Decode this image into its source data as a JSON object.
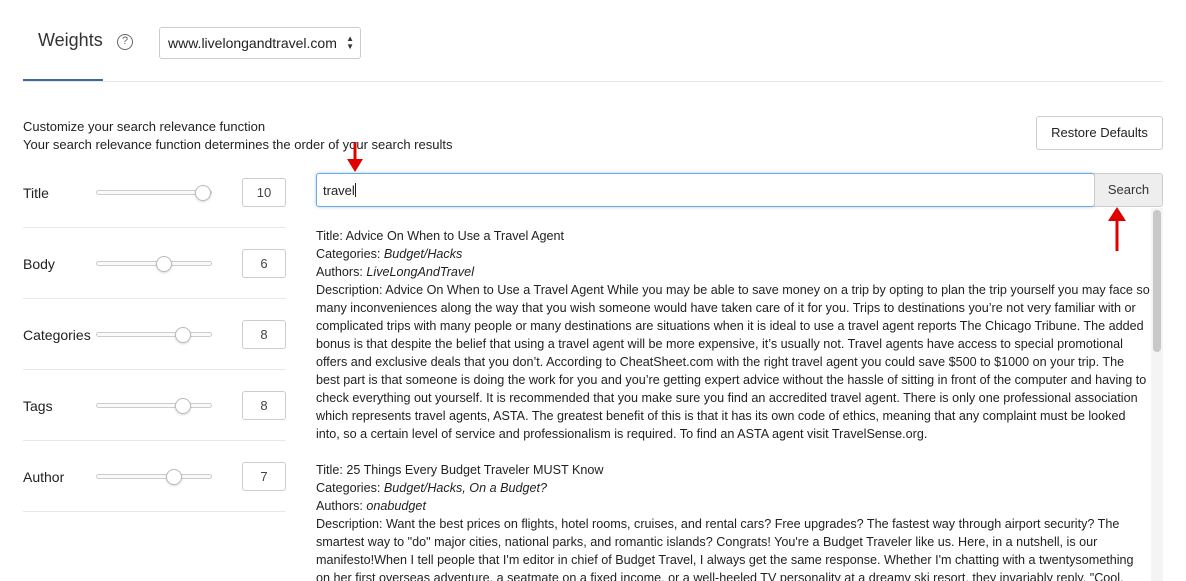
{
  "header": {
    "title": "Weights",
    "help_icon": "question-circle-icon",
    "site_select": "www.livelongandtravel.com"
  },
  "description": {
    "line1": "Customize your search relevance function",
    "line2": "Your search relevance function determines the order of your search results"
  },
  "restore_label": "Restore Defaults",
  "weights": [
    {
      "label": "Title",
      "value": "10",
      "level": 1.0
    },
    {
      "label": "Body",
      "value": "6",
      "level": 0.6
    },
    {
      "label": "Categories",
      "value": "8",
      "level": 0.8
    },
    {
      "label": "Tags",
      "value": "8",
      "level": 0.8
    },
    {
      "label": "Author",
      "value": "7",
      "level": 0.7
    }
  ],
  "search": {
    "value": "travel",
    "button_label": "Search"
  },
  "results": [
    {
      "title_label": "Title: ",
      "title": "Advice On When to Use a Travel Agent",
      "categories_label": "Categories: ",
      "categories": "Budget/Hacks",
      "authors_label": "Authors: ",
      "authors": "LiveLongAndTravel",
      "description_label": "Description: ",
      "description": "Advice On When to Use a Travel Agent While you may be able to save money on a trip by opting to plan the trip yourself you may face so many inconveniences along the way that you wish someone would have taken care of it for you. Trips to destinations you’re not very familiar with or complicated trips with many people or many destinations are situations when it is ideal to use a travel agent reports The Chicago Tribune. The added bonus is that despite the belief that using a travel agent will be more expensive, it’s usually not. Travel agents have access to special promotional offers and exclusive deals that you don’t. According to CheatSheet.com with the right travel agent you could save $500 to $1000 on your trip.  The best part is that someone is doing the work for you and you’re getting expert advice without the hassle of sitting in front of the computer and having to check everything out yourself. It is recommended that you make sure you find an accredited travel agent. There is only one professional association which represents travel agents, ASTA. The greatest benefit of this is that it has its own code of ethics, meaning that any complaint must be looked into, so a certain level of service and professionalism is required. To find an ASTA agent visit TravelSense.org."
    },
    {
      "title_label": "Title: ",
      "title": "25 Things Every Budget Traveler MUST Know",
      "categories_label": "Categories: ",
      "categories": "Budget/Hacks, On a Budget?",
      "authors_label": "Authors: ",
      "authors": "onabudget",
      "description_label": "Description: ",
      "description": "Want the best prices on flights, hotel rooms, cruises, and rental cars? Free upgrades? The fastest way through airport security? The smartest way to \"do\" major cities, national parks, and romantic islands? Congrats! You're a Budget Traveler like us. Here, in a nutshell, is our manifesto!When I tell people that I'm editor in chief of Budget Travel, I always get the same response. Whether I'm chatting with a twentysomething on her first overseas adventure, a seatmate on a fixed income, or a well-heeled TV personality at a dreamy ski resort, they invariably reply, \"Cool."
    }
  ],
  "colors": {
    "annotation_arrow": "#e00000",
    "focus_border": "#6fa8dc",
    "tab_underline": "#3c6aa0"
  }
}
